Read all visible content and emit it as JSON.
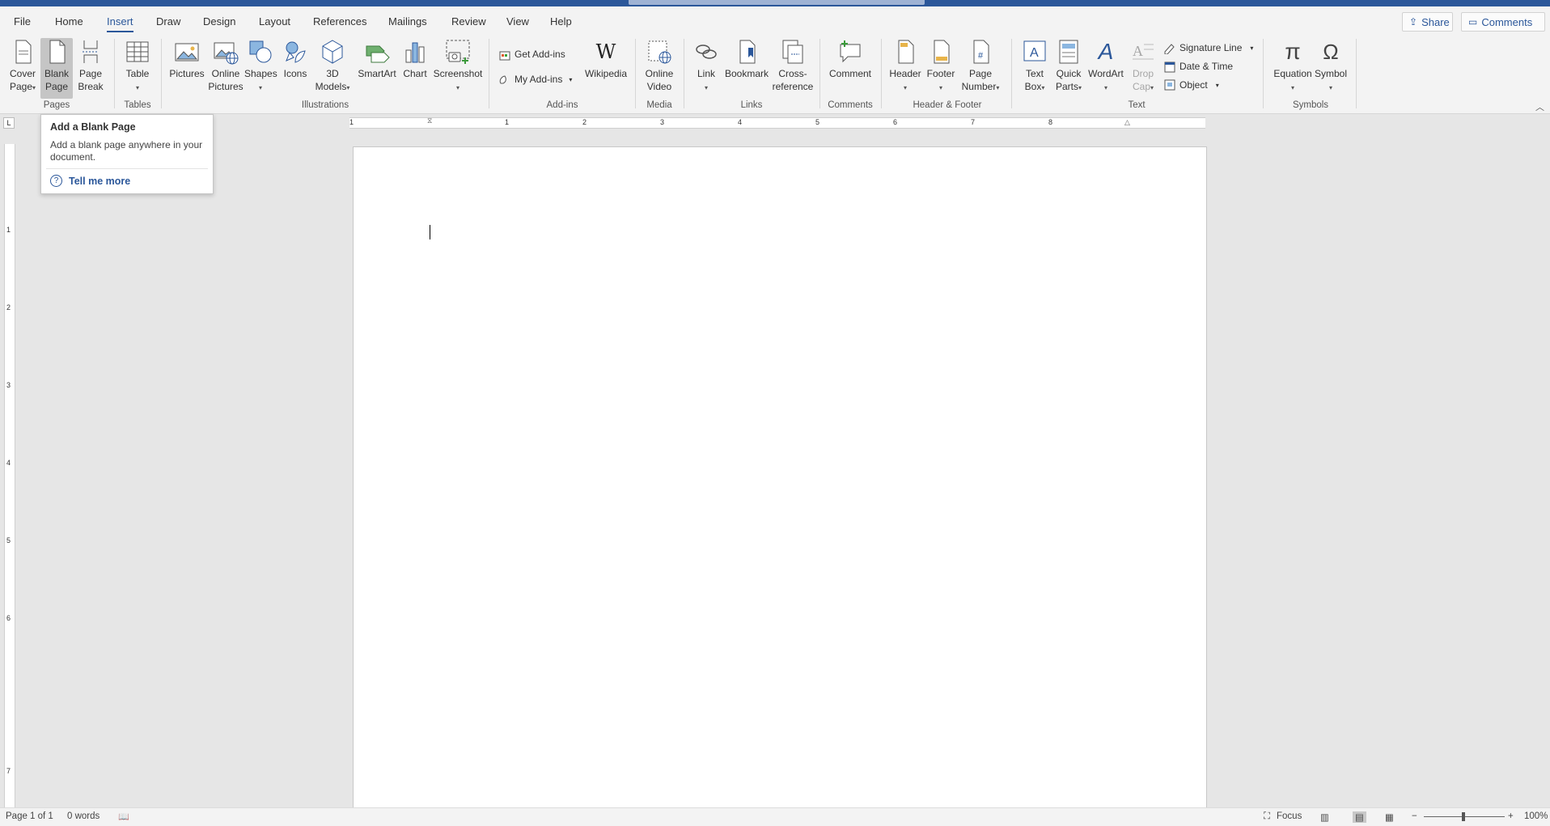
{
  "menu": {
    "tabs": [
      "File",
      "Home",
      "Insert",
      "Draw",
      "Design",
      "Layout",
      "References",
      "Mailings",
      "Review",
      "View",
      "Help"
    ],
    "active": "Insert",
    "share_label": "Share",
    "comments_label": "Comments"
  },
  "ribbon": {
    "pages": {
      "cover": [
        "Cover",
        "Page"
      ],
      "blank": [
        "Blank",
        "Page"
      ],
      "break": [
        "Page",
        "Break"
      ],
      "label": "Pages"
    },
    "tables": {
      "table": "Table",
      "label": "Tables"
    },
    "illustrations": {
      "pictures": "Pictures",
      "online": [
        "Online",
        "Pictures"
      ],
      "shapes": "Shapes",
      "icons": "Icons",
      "models": [
        "3D",
        "Models"
      ],
      "smartart": "SmartArt",
      "chart": "Chart",
      "screenshot": "Screenshot",
      "label": "Illustrations"
    },
    "addins": {
      "get": "Get Add-ins",
      "my": "My Add-ins",
      "wikipedia": "Wikipedia",
      "label": "Add-ins"
    },
    "media": {
      "video": [
        "Online",
        "Video"
      ],
      "label": "Media"
    },
    "links": {
      "link": "Link",
      "bookmark": "Bookmark",
      "cross": [
        "Cross-",
        "reference"
      ],
      "label": "Links"
    },
    "comments": {
      "comment": "Comment",
      "label": "Comments"
    },
    "header_footer": {
      "header": "Header",
      "footer": "Footer",
      "pagenum": [
        "Page",
        "Number"
      ],
      "label": "Header & Footer"
    },
    "text": {
      "textbox": [
        "Text",
        "Box"
      ],
      "quickparts": [
        "Quick",
        "Parts"
      ],
      "wordart": "WordArt",
      "dropcap": [
        "Drop",
        "Cap"
      ],
      "signature": "Signature Line",
      "datetime": "Date & Time",
      "object": "Object",
      "label": "Text"
    },
    "symbols": {
      "equation": "Equation",
      "symbol": "Symbol",
      "label": "Symbols"
    }
  },
  "tooltip": {
    "title": "Add a Blank Page",
    "body": "Add a blank page anywhere in your document.",
    "link": "Tell me more"
  },
  "ruler": {
    "h_numbers": [
      "1",
      "1",
      "2",
      "3",
      "4",
      "5",
      "6",
      "7",
      "8"
    ],
    "v_numbers": [
      "1",
      "2",
      "3",
      "4",
      "5",
      "6",
      "7"
    ]
  },
  "status": {
    "page": "Page 1 of 1",
    "words": "0 words",
    "focus": "Focus",
    "zoom_minus": "−",
    "zoom_plus": "+",
    "zoom": "100%"
  },
  "colors": {
    "accent": "#2b579a"
  }
}
